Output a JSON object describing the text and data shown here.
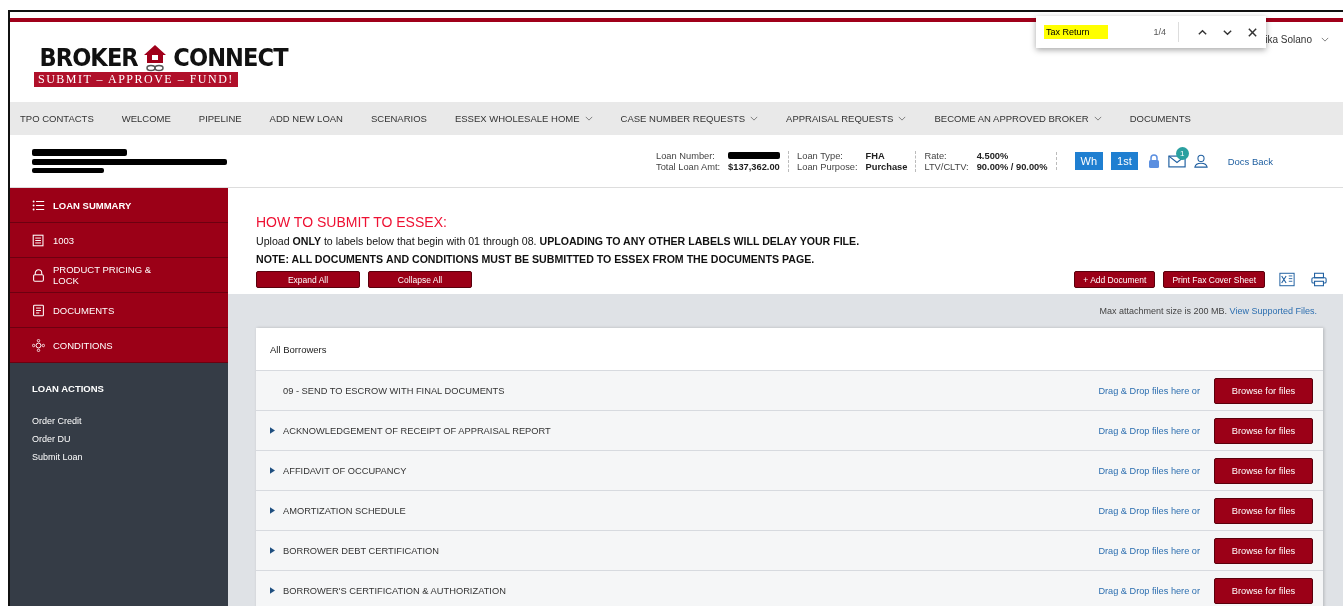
{
  "logo": {
    "wordmark_left": "BROKER",
    "wordmark_right": "CONNECT",
    "tagline": "SUBMIT – APPROVE – FUND!"
  },
  "user": {
    "name": "ika Solano"
  },
  "find_bar": {
    "value": "Tax Return",
    "count": "1/4"
  },
  "nav": [
    {
      "label": "TPO CONTACTS",
      "dropdown": false
    },
    {
      "label": "WELCOME",
      "dropdown": false
    },
    {
      "label": "PIPELINE",
      "dropdown": false
    },
    {
      "label": "ADD NEW LOAN",
      "dropdown": false
    },
    {
      "label": "SCENARIOS",
      "dropdown": false
    },
    {
      "label": "ESSEX WHOLESALE HOME",
      "dropdown": true
    },
    {
      "label": "CASE NUMBER REQUESTS",
      "dropdown": true
    },
    {
      "label": "APPRAISAL REQUESTS",
      "dropdown": true
    },
    {
      "label": "BECOME AN APPROVED BROKER",
      "dropdown": true
    },
    {
      "label": "DOCUMENTS",
      "dropdown": false
    }
  ],
  "loan_info": {
    "groups": [
      [
        {
          "label": "Loan Number:"
        },
        {
          "label": "Total Loan Amt:",
          "value": "$137,362.00"
        }
      ],
      [
        {
          "label": "Loan Type:",
          "value": "FHA"
        },
        {
          "label": "Loan Purpose:",
          "value": "Purchase"
        }
      ],
      [
        {
          "label": "Rate:",
          "value": "4.500%"
        },
        {
          "label": "LTV/CLTV:",
          "value": "90.00% / 90.00%"
        }
      ]
    ],
    "badges": [
      "Wh",
      "1st"
    ],
    "message_count": "1",
    "docs_back": "Docs Back"
  },
  "sidebar": {
    "items": [
      {
        "label": "LOAN SUMMARY",
        "bold": true
      },
      {
        "label": "1003",
        "bold": false
      },
      {
        "label": "PRODUCT PRICING & LOCK",
        "bold": false
      },
      {
        "label": "DOCUMENTS",
        "bold": false
      },
      {
        "label": "CONDITIONS",
        "bold": false
      }
    ],
    "actions_title": "LOAN ACTIONS",
    "actions": [
      "Order Credit",
      "Order DU",
      "Submit Loan"
    ]
  },
  "instructions": {
    "title": "HOW TO SUBMIT TO ESSEX:",
    "line_1": "Upload **ONLY** to labels below that begin with 01 through 08.  **UPLOADING TO ANY OTHER LABELS WILL DELAY YOUR FILE.**",
    "line_2": "NOTE: ALL DOCUMENTS **AND** CONDITIONS MUST BE SUBMITTED TO ESSEX FROM THE DOCUMENTS PAGE."
  },
  "buttons_left": [
    "Expand All",
    "Collapse All"
  ],
  "buttons_right": [
    "+ Add Document",
    "Print Fax Cover Sheet"
  ],
  "attachment_note": "Max attachment size is 200 MB.",
  "supported_link": "View Supported Files.",
  "group_title": "All Borrowers",
  "documents": [
    {
      "name": "09 - SEND TO ESCROW WITH FINAL DOCUMENTS",
      "toggle": false,
      "drop_text": "Drag & Drop files here or",
      "button": "Browse for files"
    },
    {
      "name": "ACKNOWLEDGEMENT OF RECEIPT OF APPRAISAL REPORT",
      "toggle": true,
      "drop_text": "Drag & Drop files here or",
      "button": "Browse for files"
    },
    {
      "name": "AFFIDAVIT OF OCCUPANCY",
      "toggle": true,
      "drop_text": "Drag & Drop files here or",
      "button": "Browse for files"
    },
    {
      "name": "AMORTIZATION SCHEDULE",
      "toggle": true,
      "drop_text": "Drag & Drop files here or",
      "button": "Browse for files"
    },
    {
      "name": "BORROWER DEBT CERTIFICATION",
      "toggle": true,
      "drop_text": "Drag & Drop files here or",
      "button": "Browse for files"
    },
    {
      "name": "BORROWER'S CERTIFICATION & AUTHORIZATION",
      "toggle": true,
      "drop_text": "Drag & Drop files here or",
      "button": "Browse for files"
    }
  ]
}
